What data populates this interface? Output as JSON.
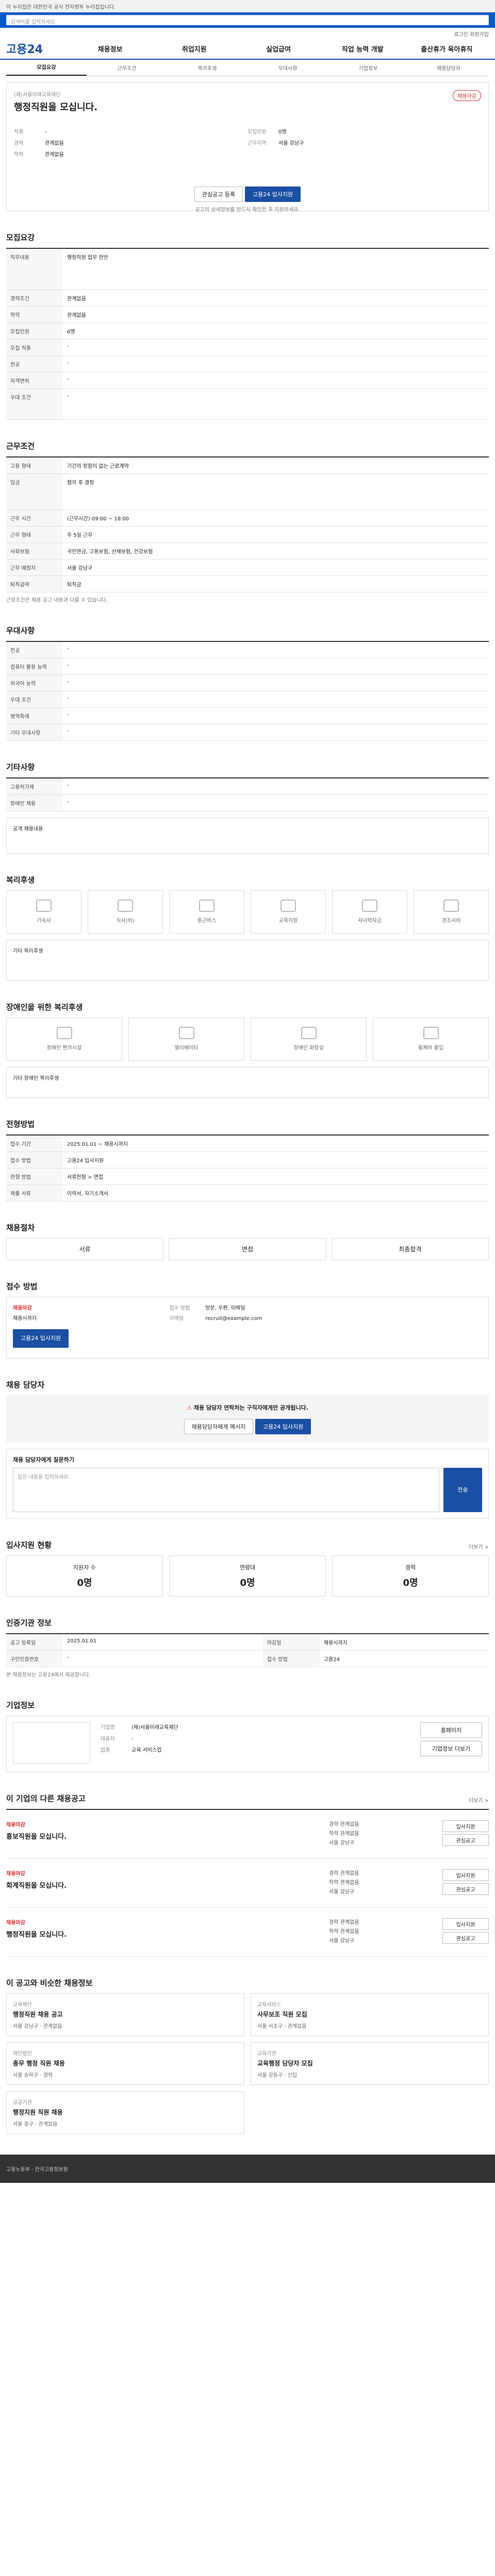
{
  "gov_bar": "이 누리집은 대한민국 공식 전자정부 누리집입니다.",
  "search": {
    "placeholder": "검색어를 입력하세요"
  },
  "toplinks": "로그인  회원가입",
  "logo": "고용24",
  "gnb": [
    "채용정보",
    "취업지원",
    "실업급여",
    "직업 능력 개발",
    "출산휴가 육아휴직"
  ],
  "tabs": [
    "모집요강",
    "근무조건",
    "복리후생",
    "우대사항",
    "기업정보",
    "채용담당자"
  ],
  "header": {
    "corp": "(재)서울미래교육재단",
    "title": "행정직원을 모십니다.",
    "badge": "채용마감",
    "left_label1": "직종",
    "left_val1": "-",
    "left_label2": "경력",
    "left_val2": "관계없음",
    "left_label3": "학력",
    "left_val3": "관계없음",
    "right_label1": "모집인원",
    "right_val1": "0명",
    "right_label2": "근무지역",
    "right_val2": "서울 강남구",
    "save_btn": "관심공고 등록",
    "apply_btn": "고용24 입사지원",
    "note": "공고의 상세정보를 반드시 확인한 후 지원하세요."
  },
  "recruit": {
    "title": "모집요강",
    "rows": [
      {
        "k": "직무내용",
        "v": "행정직원 업무 전반"
      },
      {
        "k": "경력조건",
        "v": "관계없음"
      },
      {
        "k": "학력",
        "v": "관계없음"
      },
      {
        "k": "모집인원",
        "v": "0명"
      },
      {
        "k": "모집 직종",
        "v": "-"
      },
      {
        "k": "전공",
        "v": "-"
      },
      {
        "k": "자격면허",
        "v": "-"
      },
      {
        "k": "우대 조건",
        "v": "-"
      }
    ]
  },
  "work": {
    "title": "근무조건",
    "rows": [
      {
        "k": "고용 형태",
        "v": "기간의 정함이 없는 근로계약"
      },
      {
        "k": "임금",
        "v": "협의 후 결정"
      },
      {
        "k": "근무 시간",
        "v": "(근무시간) 09:00 ~ 18:00"
      },
      {
        "k": "근무 형태",
        "v": "주 5일 근무"
      },
      {
        "k": "사회보험",
        "v": "국민연금, 고용보험, 산재보험, 건강보험"
      },
      {
        "k": "근무 예정지",
        "v": "서울 강남구"
      },
      {
        "k": "퇴직급여",
        "v": "퇴직금"
      }
    ],
    "note": "근로조건은 채용 공고 내용과 다를 수 있습니다."
  },
  "pref": {
    "title": "우대사항",
    "rows": [
      {
        "k": "전공",
        "v": "-"
      },
      {
        "k": "컴퓨터 활용 능력",
        "v": "-"
      },
      {
        "k": "외국어 능력",
        "v": "-"
      },
      {
        "k": "우대 조건",
        "v": "-"
      },
      {
        "k": "병역특례",
        "v": "-"
      },
      {
        "k": "기타 우대사항",
        "v": "-"
      }
    ]
  },
  "extra": {
    "title": "기타사항",
    "rows": [
      {
        "k": "고용허가제",
        "v": "-"
      },
      {
        "k": "장애인 채용",
        "v": "-"
      }
    ],
    "link": "공개 채용내용"
  },
  "welfare": {
    "title": "복리후생",
    "items": [
      "기숙사",
      "식사(비)",
      "통근버스",
      "교육지원",
      "자녀학자금",
      "경조사비"
    ],
    "note": "기타 복리후생"
  },
  "disabled": {
    "title": "장애인을 위한 복리후생",
    "items": [
      "장애인 편의시설",
      "엘리베이터",
      "장애인 화장실",
      "휠체어 출입"
    ],
    "note": "기타 장애인 복리후생"
  },
  "process": {
    "title": "전형방법",
    "rows": [
      {
        "k": "접수 기간",
        "v": "2025.01.01 ~ 채용시까지"
      },
      {
        "k": "접수 방법",
        "v": "고용24 입사지원"
      },
      {
        "k": "전형 방법",
        "v": "서류전형 > 면접"
      },
      {
        "k": "제출 서류",
        "v": "이력서, 자기소개서"
      }
    ]
  },
  "steps": {
    "title": "채용절차",
    "items": [
      "서류",
      "면접",
      "최종합격"
    ]
  },
  "apply": {
    "title": "접수 방법",
    "status_label": "채용마감",
    "deadline": "채용시까지",
    "apply_btn": "고용24 입사지원",
    "method_label": "접수 방법",
    "method_val": "방문, 우편, 이메일",
    "email_label": "이메일",
    "email_val": "recruit@example.com"
  },
  "contact": {
    "title": "채용 담당자",
    "notice": "채용 담당자 연락처는 구직자에게만 공개됩니다.",
    "msg_btn": "채용담당자에게 메시지",
    "call_btn": "고용24 입사지원",
    "inquiry_title": "채용 담당자에게 질문하기",
    "inquiry_placeholder": "질문 내용을 입력하세요.",
    "send_btn": "전송"
  },
  "stats": {
    "title": "입사지원 현황",
    "more": "더보기 >",
    "cards": [
      {
        "label": "지원자 수",
        "num": "0명"
      },
      {
        "label": "연령대",
        "num": "0명"
      },
      {
        "label": "경력",
        "num": "0명"
      }
    ]
  },
  "posting": {
    "title": "인증기관 정보",
    "rows": [
      {
        "k": "공고 등록일",
        "v": "2025.01.01"
      },
      {
        "k": "마감일",
        "v": "채용시까지"
      },
      {
        "k": "구인인증번호",
        "v": "-"
      },
      {
        "k": "접수 방법",
        "v": "고용24"
      }
    ],
    "note": "본 채용정보는 고용24에서 제공합니다."
  },
  "company": {
    "title": "기업정보",
    "name_label": "기업명",
    "name_val": "(재)서울미래교육재단",
    "ceo_label": "대표자",
    "ceo_val": "-",
    "type_label": "업종",
    "type_val": "교육 서비스업",
    "size_label": "기업규모",
    "size_val": "-",
    "home_btn": "홈페이지",
    "info_btn": "기업정보 더보기"
  },
  "related": {
    "title": "이 기업의 다른 채용공고",
    "more": "더보기 >",
    "items": [
      {
        "status": "채용마감",
        "title": "홍보직원을 모십니다.",
        "m1": "경력 관계없음",
        "m2": "학력 관계없음",
        "m3": "서울 강남구"
      },
      {
        "status": "채용마감",
        "title": "회계직원을 모십니다.",
        "m1": "경력 관계없음",
        "m2": "학력 관계없음",
        "m3": "서울 강남구"
      },
      {
        "status": "채용마감",
        "title": "행정직원을 모십니다.",
        "m1": "경력 관계없음",
        "m2": "학력 관계없음",
        "m3": "서울 강남구"
      }
    ],
    "btn_a": "입사지원",
    "btn_b": "관심공고"
  },
  "recommend": {
    "title": "이 공고와 비슷한 채용정보",
    "items": [
      {
        "c": "교육재단",
        "t": "행정직원 채용 공고",
        "d": "서울 강남구 · 관계없음"
      },
      {
        "c": "교육서비스",
        "t": "사무보조 직원 모집",
        "d": "서울 서초구 · 관계없음"
      },
      {
        "c": "재단법인",
        "t": "총무 행정 직원 채용",
        "d": "서울 송파구 · 경력"
      },
      {
        "c": "교육기관",
        "t": "교육행정 담당자 모집",
        "d": "서울 강동구 · 신입"
      },
      {
        "c": "공공기관",
        "t": "행정지원 직원 채용",
        "d": "서울 중구 · 관계없음"
      }
    ]
  },
  "footer": "고용노동부 · 한국고용정보원"
}
